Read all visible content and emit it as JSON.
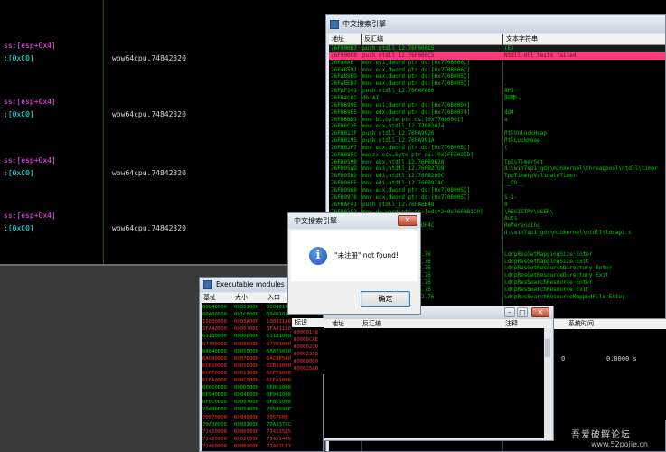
{
  "background_pane": {
    "rows": [
      {
        "op": "ss:[esp+0x4]",
        "call": ""
      },
      {
        "op": ":[0xC0]",
        "call": "wow64cpu.74842320"
      },
      {
        "op": "ss:[esp+0x4]",
        "call": ""
      },
      {
        "op": ":[0xC0]",
        "call": "wow64cpu.74842320"
      },
      {
        "op": "ss:[esp+0x4]",
        "call": ""
      },
      {
        "op": ":[0xC0]",
        "call": "wow64cpu.74842320"
      },
      {
        "op": "ss:[esp+0x4]",
        "call": ""
      },
      {
        "op": ":[0xC0]",
        "call": "wow64cpu.74842320"
      }
    ]
  },
  "search_window": {
    "title": "中文搜索引擎",
    "columns": {
      "address": "地址",
      "disasm": "反汇编",
      "string": "文本字符串"
    },
    "rows": [
      {
        "addr": "76F900B7",
        "dis": "push ntdll_12.76F900C5",
        "str": "(E)"
      },
      {
        "addr": "76F900C0",
        "dis": "push ntdll_12.76F900C5",
        "str": "Ntdll.dll tests failed"
      },
      {
        "addr": "76FA4AE",
        "dis": "mov esi,dword ptr ds:[0x7708006C]",
        "str": ""
      },
      {
        "addr": "76FA8597",
        "dis": "mov ecx,dword ptr ds:[0x7708006C]",
        "str": ""
      },
      {
        "addr": "76FA89ED",
        "dis": "mov eax,dword ptr ds:[0x7708005C]",
        "str": ""
      },
      {
        "addr": "76FAEED7",
        "dis": "mov eax,dword ptr ds:[0x7708005C]",
        "str": "."
      },
      {
        "addr": "76FAF141",
        "dis": "push ntdll_12.76FAF860",
        "str": "API-"
      },
      {
        "addr": "76FB4C8C",
        "dis": "db AI",
        "str": "脳鍵L"
      },
      {
        "addr": "76FB699E",
        "dis": "mov esi,dword ptr ds:[0x770800D0]",
        "str": ""
      },
      {
        "addr": "76FB69E5",
        "dis": "mov edx,dword ptr ds:[0x77080074]",
        "str": "dd4"
      },
      {
        "addr": "76FB6BD1",
        "dis": "mov bl,byte ptr ds:[0x77080001]",
        "str": "a"
      },
      {
        "addr": "76FB6C3E",
        "dis": "mov ecx,ntdll_12.77082074",
        "str": ""
      },
      {
        "addr": "76FB813F",
        "dis": "push ntdll_12.76FA9926",
        "str": "RtlUnlockHeap"
      },
      {
        "addr": "76FB8195",
        "dis": "push ntdll_12.76FA991A",
        "str": "RtlLockHeap"
      },
      {
        "addr": "76FB82F7",
        "dis": "mov ecx,dword ptr ds:[0x7708005C]",
        "str": "("
      },
      {
        "addr": "76FB88FC",
        "dis": "movzx ecx,byte ptr ds:[0x7FFE02ED]",
        "str": ""
      },
      {
        "addr": "76FB959B",
        "dis": "mov ebx,ntdll_12.76FB9628",
        "str": "TpIsTimerSet"
      },
      {
        "addr": "76FB95AD",
        "dis": "mov esi,ntdll_12.76FB27D8",
        "str": "d:\\win7sp1_gdr\\minkernel\\threadpool\\ntdll\\timer"
      },
      {
        "addr": "76FB95B2",
        "dis": "mov edi,ntdll_12.76FB280C",
        "str": "TppTimerpValidateTimer"
      },
      {
        "addr": "76FB96FE",
        "dis": "mov edi,ntdll_12.76FB974C",
        "str": "__CD__"
      },
      {
        "addr": "76FB9968",
        "dis": "mov ecx,dword ptr ds:[0x7708005C]",
        "str": ""
      },
      {
        "addr": "76FB9978",
        "dis": "mov ecx,dword ptr ds:[0x7708005C]",
        "str": "S-1-"
      },
      {
        "addr": "76FBAF41",
        "dis": "push ntdll_12.76FAEE48",
        "str": "0"
      },
      {
        "addr": "76FB8152",
        "dis": "mov dx,word ptr ds:[edx*2+0x76FBB1C0]",
        "str": "\\REGISTRY\\USER\\"
      },
      {
        "addr": "",
        "dis": "1_12.76FB68A",
        "str": "Acts"
      },
      {
        "addr": "",
        "dis": "ecx],ntdll_12.76FCOF4C",
        "str": "Referencing"
      },
      {
        "addr": "",
        "dis": "12.76FA4AE",
        "str": "d:\\win7sp1_gdr\\minkernel\\ntdll\\ldrapi.c"
      },
      {
        "addr": "",
        "dis": "12.76FA29DA",
        "str": ""
      },
      {
        "addr": "",
        "dis": "0200",
        "str": ""
      },
      {
        "addr": "",
        "dis": "ebp-0x38],ntdll_12.76",
        "str": "LdrpResGetMappingSize Enter"
      },
      {
        "addr": "",
        "dis": "ebp-0x40],ntdll_12.76",
        "str": "LdrpResGetMappingSize Exit"
      },
      {
        "addr": "",
        "dis": "ebp-0x34],ntdll_12.76",
        "str": "LdrpResGetResourceDirectory Enter"
      },
      {
        "addr": "",
        "dis": "ebp-0x40],ntdll_12.76",
        "str": "LdrpResGetResourceDirectory Exit"
      },
      {
        "addr": "",
        "dis": "ebp-0x48],ntdll_12.76",
        "str": "LdrpResSearchResource Enter"
      },
      {
        "addr": "",
        "dis": "ebp-0x50],ntdll_12.76",
        "str": "LdrpResSearchResource Exit"
      },
      {
        "addr": "",
        "dis": "ebp-0x120],ntdll_12.76",
        "str": "LdrpResSearchResourceMappedFile Enter"
      }
    ]
  },
  "lower_window": {
    "columns": {
      "address": "地址",
      "disasm": "反汇编",
      "comment": "注释"
    },
    "right_column": "系统时间",
    "values": [
      "0",
      "0.0000 s"
    ]
  },
  "label_panel": {
    "header": "标识",
    "values": [
      "00000138",
      "0000DCAE",
      "00000210",
      "00002358",
      "00000000",
      "00002580"
    ]
  },
  "modules_window": {
    "title": "Executable modules",
    "columns": {
      "base": "基址",
      "size": "大小",
      "entry": "入口"
    },
    "rows": [
      {
        "base": "00040000",
        "size": "00001000",
        "entry": "00040120",
        "color": "g"
      },
      {
        "base": "00400000",
        "size": "001CB000",
        "entry": "0040101B",
        "color": "g"
      },
      {
        "base": "10000000",
        "size": "0003A000",
        "entry": "100021A8",
        "color": "r"
      },
      {
        "base": "3FA40000",
        "size": "0000700D",
        "entry": "3FA41180",
        "color": "r"
      },
      {
        "base": "61180000",
        "size": "00068000",
        "entry": "61181000",
        "color": "g"
      },
      {
        "base": "67700000",
        "size": "00088000",
        "entry": "67701000",
        "color": "r"
      },
      {
        "base": "68840000",
        "size": "00055000",
        "entry": "68871010",
        "color": "g"
      },
      {
        "base": "6AC80000",
        "size": "00070000",
        "entry": "6AC8F540",
        "color": "r"
      },
      {
        "base": "6CB10000",
        "size": "00050000",
        "entry": "6CB11000",
        "color": "r"
      },
      {
        "base": "6CFF0000",
        "size": "00013000",
        "entry": "6CFF1000",
        "color": "r"
      },
      {
        "base": "6CFA0000",
        "size": "000C5000",
        "entry": "6CFA1000",
        "color": "r"
      },
      {
        "base": "6E0C0000",
        "size": "000D5000",
        "entry": "6E0C1000",
        "color": "g"
      },
      {
        "base": "6E940000",
        "size": "0004E000",
        "entry": "6E941000",
        "color": "g"
      },
      {
        "base": "6FBC0000",
        "size": "00007000",
        "entry": "6FBC1000",
        "color": "g"
      },
      {
        "base": "704B0000",
        "size": "00054000",
        "entry": "7050998E",
        "color": "g"
      },
      {
        "base": "70570000",
        "size": "00040000",
        "entry": "7057C00",
        "color": "r"
      },
      {
        "base": "70A30000",
        "size": "00032000",
        "entry": "70A3376C",
        "color": "g"
      },
      {
        "base": "71410000",
        "size": "00060000",
        "entry": "71413585",
        "color": "r"
      },
      {
        "base": "71420000",
        "size": "0002C000",
        "entry": "71421449",
        "color": "r"
      },
      {
        "base": "71460000",
        "size": "00009000",
        "entry": "71461C87",
        "color": "r"
      },
      {
        "base": "71550000",
        "size": "00008000",
        "entry": "71551000",
        "color": "r"
      }
    ]
  },
  "message_box": {
    "title": "中文搜索引擎",
    "message": "\"未注册\" not found!",
    "ok_label": "确定"
  },
  "watermark": {
    "logo": "吾爱破解论坛",
    "url": "www.52pojie.cn"
  },
  "colors": {
    "code_green": "#00d000",
    "selection_pink": "#ff3a78",
    "module_red": "#ff3030",
    "register_magenta": "#ff4dff"
  }
}
